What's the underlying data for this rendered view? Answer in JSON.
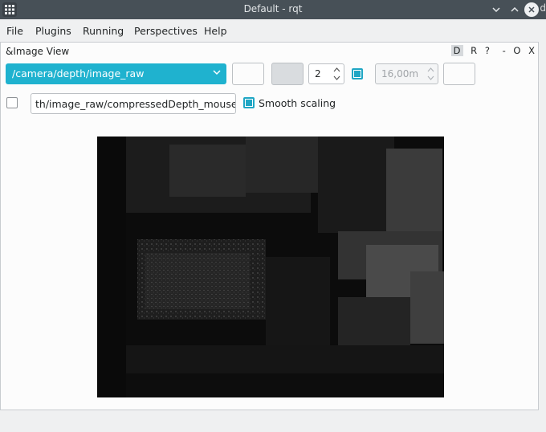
{
  "window": {
    "title": "Default - rqt",
    "edge_letter": "d"
  },
  "menu": [
    "File",
    "Plugins",
    "Running",
    "Perspectives",
    "Help"
  ],
  "dock": {
    "title": "&Image View",
    "controls": {
      "d": "D",
      "r": "R",
      "help": "?",
      "minus": "-",
      "o": "O",
      "close": "X"
    }
  },
  "toolbar": {
    "topic": "/camera/depth/image_raw",
    "spin_value": "2",
    "overlay_checked": true,
    "max_range": "16,00m"
  },
  "row2": {
    "mouse_checked": false,
    "topic_field": "th/image_raw/compressedDepth_mouse_left",
    "smooth_label": "Smooth scaling",
    "smooth_checked": true
  },
  "colors": {
    "accent": "#1fb2cf",
    "titlebar": "#475057"
  }
}
